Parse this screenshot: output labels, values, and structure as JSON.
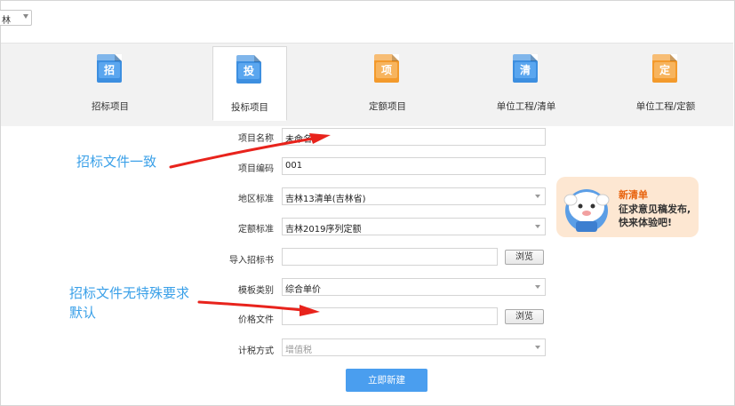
{
  "top_select": {
    "value": "林"
  },
  "tabs": [
    {
      "label": "招标项目",
      "glyph": "招",
      "color": "#3d8fe0"
    },
    {
      "label": "投标项目",
      "glyph": "投",
      "color": "#3d8fe0"
    },
    {
      "label": "定额项目",
      "glyph": "项",
      "color": "#f39a2c"
    },
    {
      "label": "单位工程/清单",
      "glyph": "清",
      "color": "#3d8fe0"
    },
    {
      "label": "单位工程/定额",
      "glyph": "定",
      "color": "#f39a2c"
    }
  ],
  "form": {
    "project_name": {
      "label": "项目名称",
      "value": "未命名"
    },
    "project_code": {
      "label": "项目编码",
      "value": "001"
    },
    "region_standard": {
      "label": "地区标准",
      "value": "吉林13清单(吉林省)"
    },
    "quota_standard": {
      "label": "定额标准",
      "value": "吉林2019序列定额"
    },
    "tender_doc": {
      "label": "导入招标书",
      "value": "",
      "browse": "浏览"
    },
    "template_type": {
      "label": "模板类别",
      "value": "综合单价"
    },
    "price_file": {
      "label": "价格文件",
      "value": "",
      "browse": "浏览"
    },
    "tax_method": {
      "label": "计税方式",
      "value": "增值税"
    }
  },
  "create_button": "立即新建",
  "annotations": {
    "note1": "招标文件一致",
    "note2_line1": "招标文件无特殊要求",
    "note2_line2": "默认"
  },
  "banner": {
    "title": "新清单",
    "line1": "征求意见稿发布,",
    "line2": "快来体验吧!"
  },
  "colors": {
    "accent": "#4a9eef",
    "annotation": "#3aa0e8",
    "arrow": "#e8231c",
    "banner_bg": "#fde7d2"
  }
}
